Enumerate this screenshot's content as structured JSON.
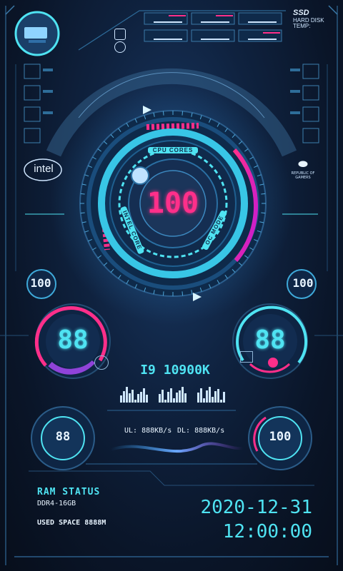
{
  "cpu": {
    "model": "I9 10900K",
    "load": "100",
    "ring_label_top": "CPU CORES",
    "ring_label_left": "INTEL CORE",
    "ring_label_right": "OC MODE",
    "load_fraction": 1.0
  },
  "brands": {
    "intel": "intel",
    "rog_line1": "REPUBLIC OF",
    "rog_line2": "GAMERS"
  },
  "ssd": {
    "title": "SSD",
    "line1": "HARD DISK",
    "line2": "TEMP:"
  },
  "gauges": {
    "left_small": "100",
    "right_small": "100",
    "left_big": "88",
    "right_big": "88",
    "bottom_left": "88",
    "bottom_right": "100"
  },
  "network": {
    "upload": "UL: 888KB/s",
    "download": "DL: 888KB/s"
  },
  "ram": {
    "title": "RAM STATUS",
    "type": "DDR4-16GB",
    "used": "USED SPACE 8888M"
  },
  "clock": {
    "date": "2020-12-31",
    "time": "12:00:00"
  },
  "colors": {
    "cyan": "#4fe3f2",
    "pink": "#ff2f8a",
    "purple": "#b04bff"
  },
  "icons": {
    "avatar": "computer-desk-icon",
    "settings": "grid-icon"
  }
}
